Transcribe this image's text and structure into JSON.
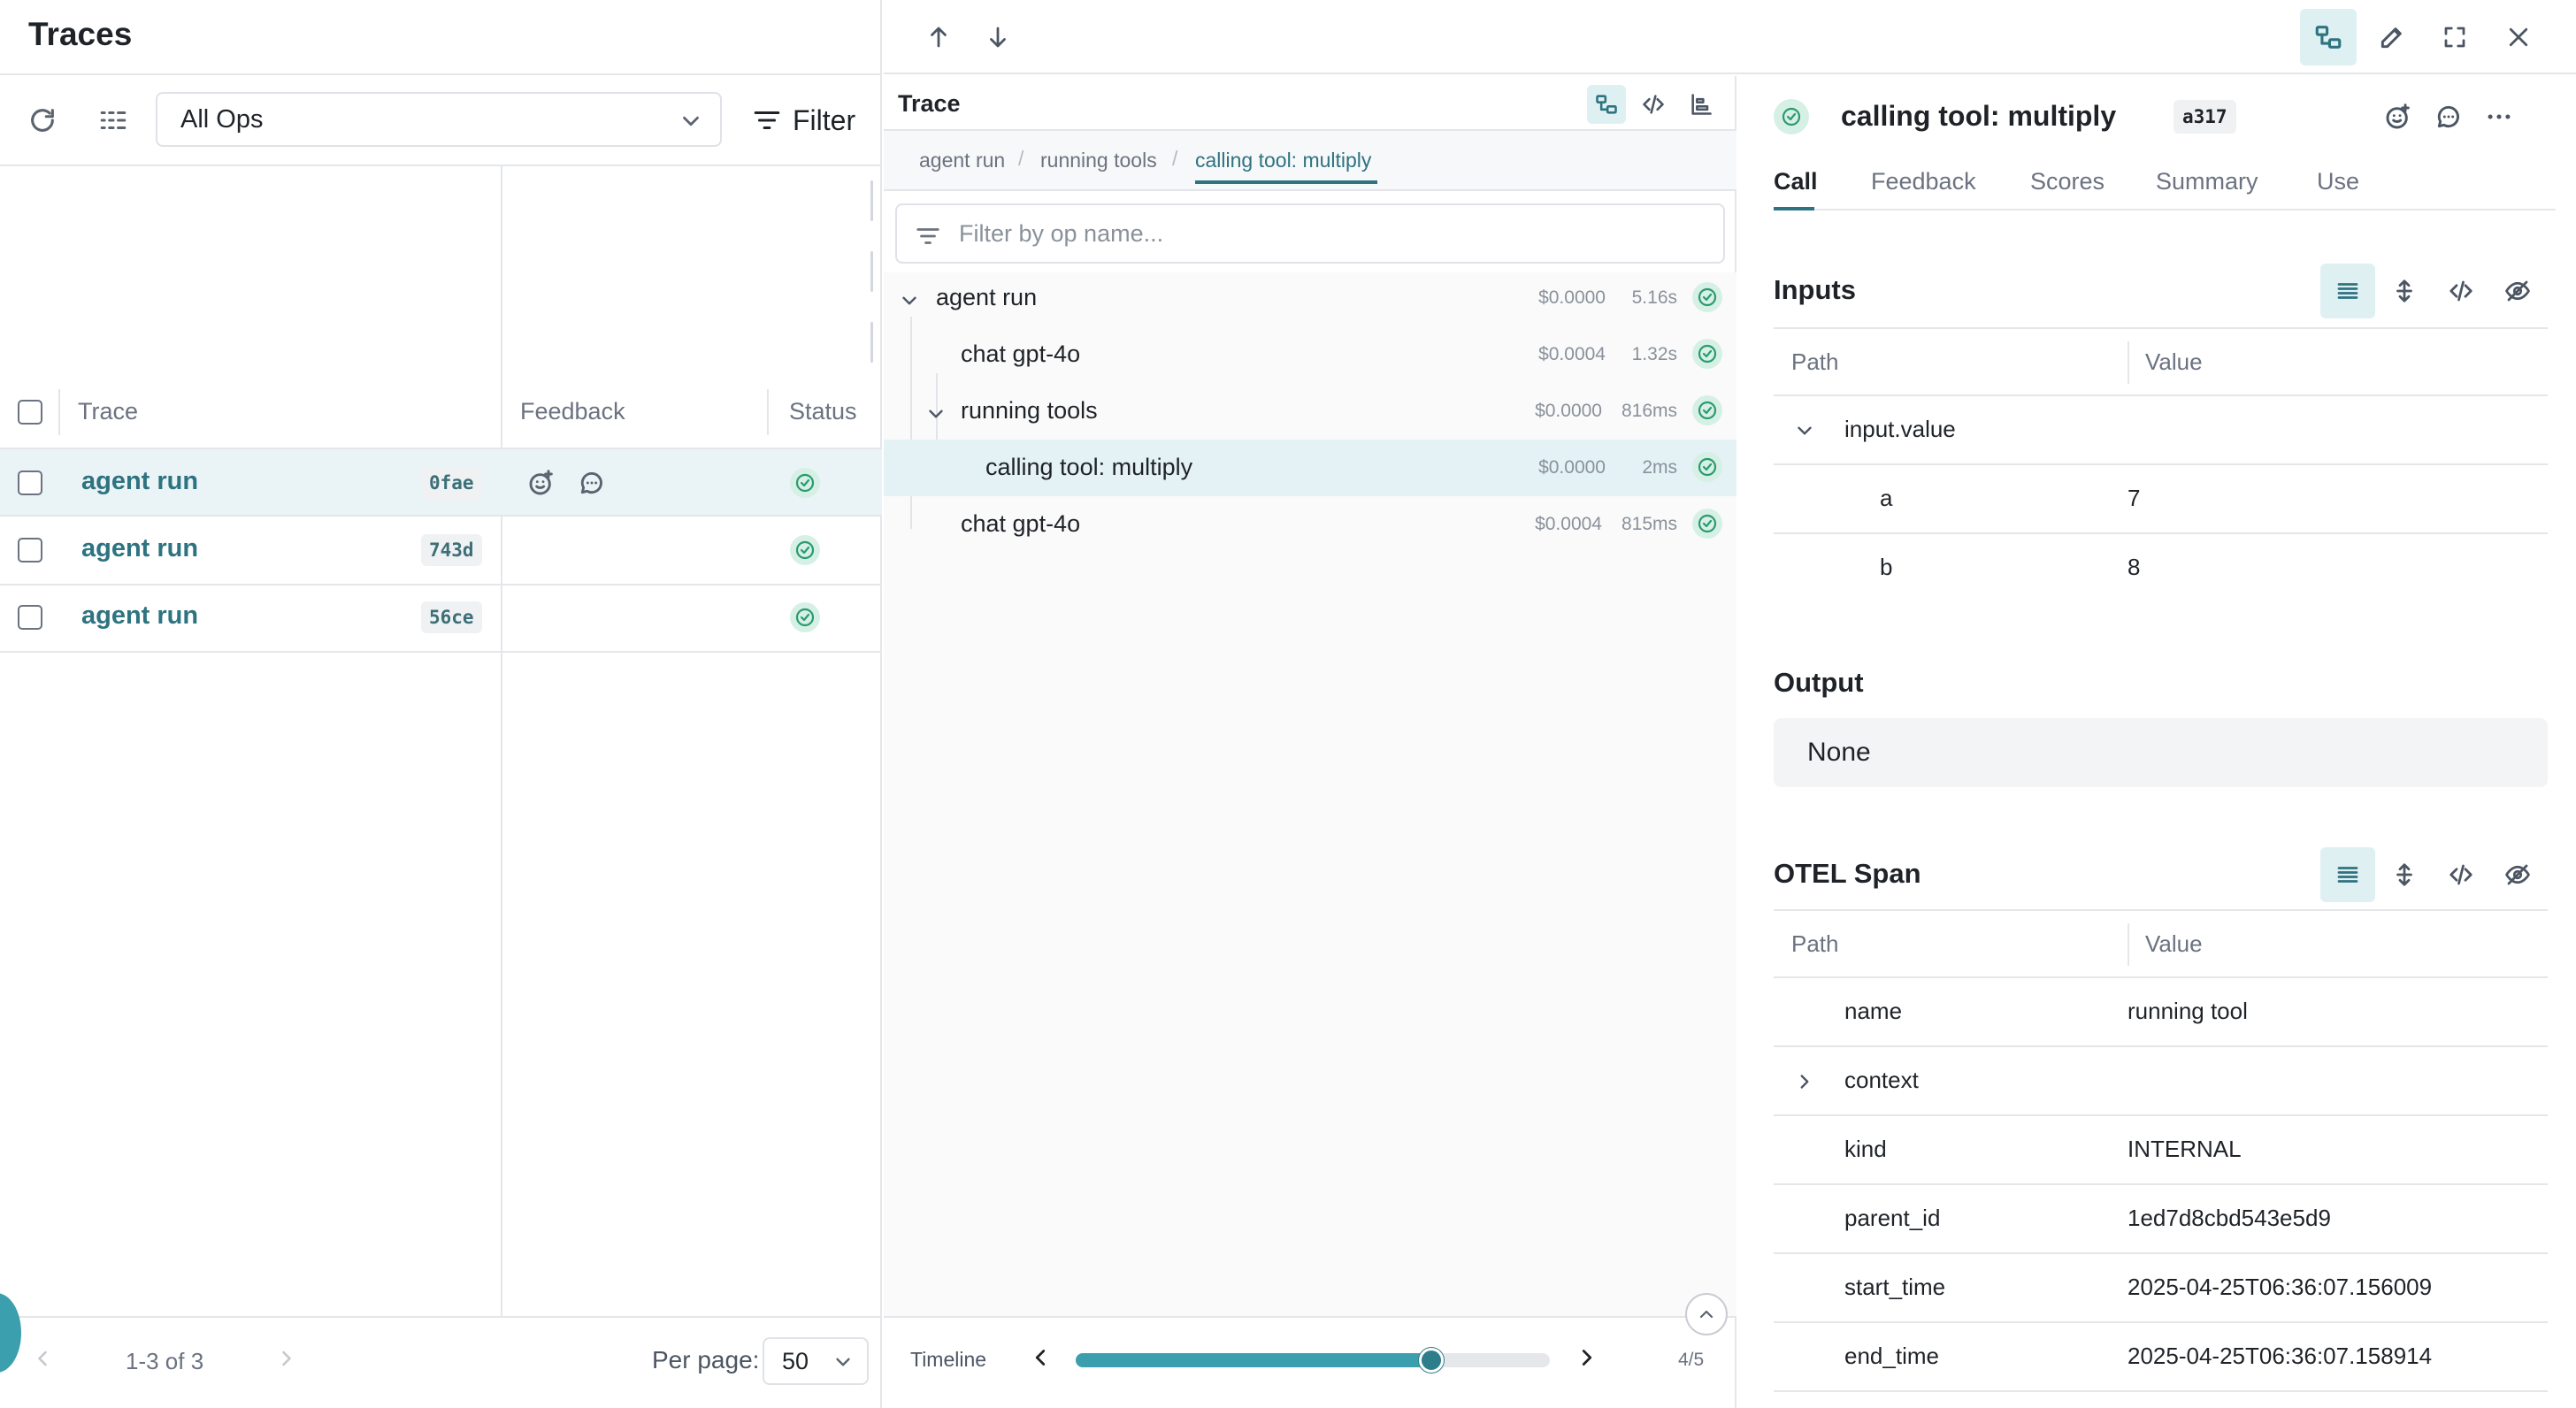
{
  "left": {
    "title": "Traces",
    "ops_select": "All Ops",
    "filter_label": "Filter",
    "columns": {
      "trace": "Trace",
      "feedback": "Feedback",
      "status": "Status"
    },
    "rows": [
      {
        "name": "agent run",
        "id": "0fae",
        "selected": true
      },
      {
        "name": "agent run",
        "id": "743d",
        "selected": false
      },
      {
        "name": "agent run",
        "id": "56ce",
        "selected": false
      }
    ],
    "pagination": {
      "range": "1-3 of 3",
      "per_page_label": "Per page:",
      "per_page_value": "50"
    }
  },
  "trace": {
    "title": "Trace",
    "breadcrumbs": [
      "agent run",
      "running tools",
      "calling tool: multiply"
    ],
    "search_placeholder": "Filter by op name...",
    "nodes": [
      {
        "name": "agent run",
        "cost": "$0.0000",
        "duration": "5.16s"
      },
      {
        "name": "chat gpt-4o",
        "cost": "$0.0004",
        "duration": "1.32s"
      },
      {
        "name": "running tools",
        "cost": "$0.0000",
        "duration": "816ms"
      },
      {
        "name": "calling tool: multiply",
        "cost": "$0.0000",
        "duration": "2ms"
      },
      {
        "name": "chat gpt-4o",
        "cost": "$0.0004",
        "duration": "815ms"
      }
    ],
    "timeline_label": "Timeline",
    "timeline_progress": 0.75,
    "timeline_count": "4/5"
  },
  "detail": {
    "title": "calling tool: multiply",
    "id": "a317",
    "tabs": [
      "Call",
      "Feedback",
      "Scores",
      "Summary",
      "Use"
    ],
    "inputs": {
      "title": "Inputs",
      "path_header": "Path",
      "value_header": "Value",
      "group": "input.value",
      "rows": [
        {
          "key": "a",
          "value": "7"
        },
        {
          "key": "b",
          "value": "8"
        }
      ]
    },
    "output": {
      "title": "Output",
      "value": "None"
    },
    "otel": {
      "title": "OTEL Span",
      "path_header": "Path",
      "value_header": "Value",
      "rows": [
        {
          "key": "name",
          "value": "running tool"
        },
        {
          "key": "context",
          "value": ""
        },
        {
          "key": "kind",
          "value": "INTERNAL"
        },
        {
          "key": "parent_id",
          "value": "1ed7d8cbd543e5d9"
        },
        {
          "key": "start_time",
          "value": "2025-04-25T06:36:07.156009"
        },
        {
          "key": "end_time",
          "value": "2025-04-25T06:36:07.158914"
        }
      ]
    }
  },
  "colors": {
    "accent": "#2e7380",
    "accent_light": "#dff0f3",
    "success": "#2b9a6e",
    "success_bg": "#d6f0e6"
  }
}
